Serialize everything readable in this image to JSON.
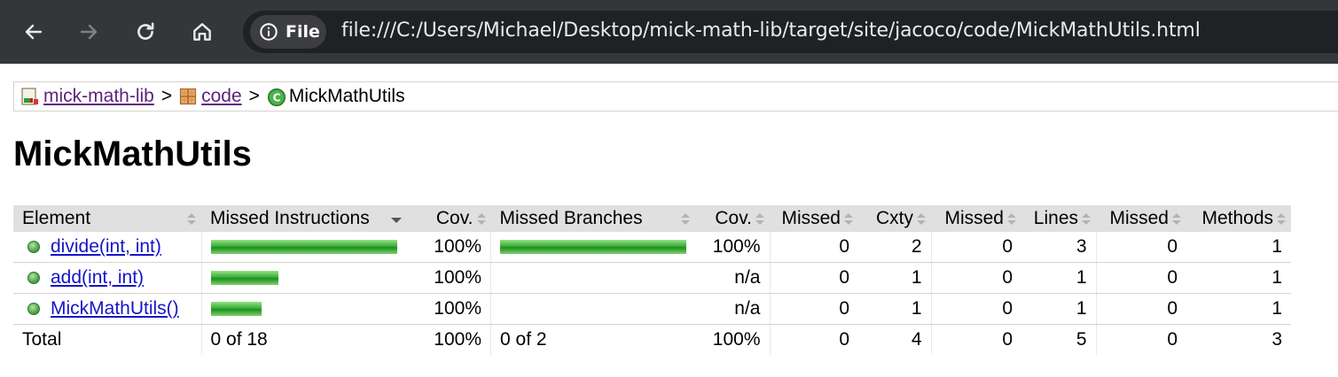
{
  "browser": {
    "back_icon": "arrow-left-icon",
    "forward_icon": "arrow-right-icon",
    "reload_icon": "reload-icon",
    "home_icon": "home-icon",
    "chip_label": "File",
    "url": "file:///C:/Users/Michael/Desktop/mick-math-lib/target/site/jacoco/code/MickMathUtils.html"
  },
  "breadcrumb": {
    "items": [
      {
        "label": "mick-math-lib",
        "icon": "report-icon",
        "link": true
      },
      {
        "label": "code",
        "icon": "package-icon",
        "link": true
      },
      {
        "label": "MickMathUtils",
        "icon": "class-icon",
        "link": false
      }
    ],
    "separator": ">"
  },
  "page": {
    "title": "MickMathUtils"
  },
  "table": {
    "headers": [
      "Element",
      "Missed Instructions",
      "Cov.",
      "Missed Branches",
      "Cov.",
      "Missed",
      "Cxty",
      "Missed",
      "Lines",
      "Missed",
      "Methods"
    ],
    "rows": [
      {
        "name": "divide(int, int)",
        "instr_bar": 1.0,
        "instr_cov": "100%",
        "branch_bar": 1.0,
        "branch_cov": "100%",
        "missed_cxty": "0",
        "cxty": "2",
        "missed_lines": "0",
        "lines": "3",
        "missed_methods": "0",
        "methods": "1"
      },
      {
        "name": "add(int, int)",
        "instr_bar": 0.36,
        "instr_cov": "100%",
        "branch_bar": 0,
        "branch_cov": "n/a",
        "missed_cxty": "0",
        "cxty": "1",
        "missed_lines": "0",
        "lines": "1",
        "missed_methods": "0",
        "methods": "1"
      },
      {
        "name": "MickMathUtils()",
        "instr_bar": 0.27,
        "instr_cov": "100%",
        "branch_bar": 0,
        "branch_cov": "n/a",
        "missed_cxty": "0",
        "cxty": "1",
        "missed_lines": "0",
        "lines": "1",
        "missed_methods": "0",
        "methods": "1"
      }
    ],
    "total": {
      "label": "Total",
      "instr": "0 of 18",
      "instr_cov": "100%",
      "branch": "0 of 2",
      "branch_cov": "100%",
      "missed_cxty": "0",
      "cxty": "4",
      "missed_lines": "0",
      "lines": "5",
      "missed_methods": "0",
      "methods": "3"
    },
    "colors": {
      "bar_green": "#35b035",
      "header_bg": "#e0e0e0"
    }
  }
}
